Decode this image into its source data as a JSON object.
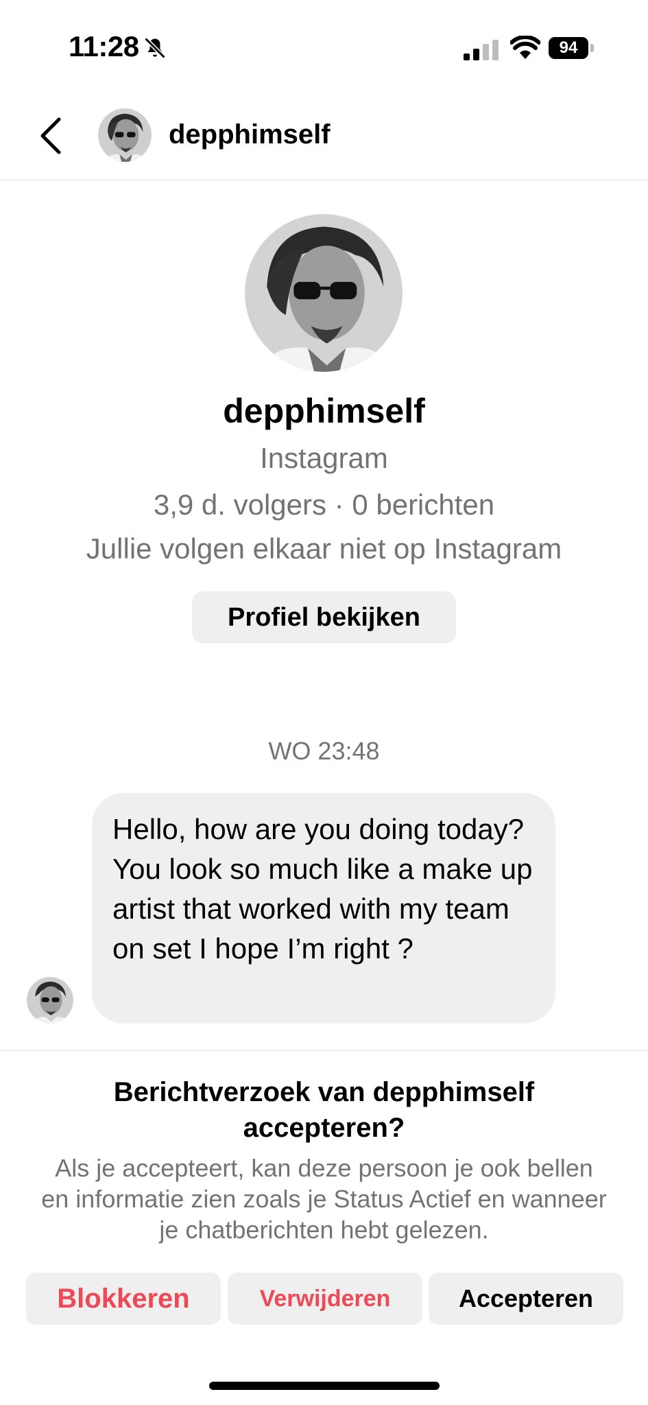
{
  "status_bar": {
    "time": "11:28",
    "battery": "94",
    "mute_icon": "bell-slash-icon"
  },
  "header": {
    "username": "depphimself"
  },
  "profile": {
    "name": "depphimself",
    "subtitle": "Instagram",
    "stats": "3,9 d. volgers · 0 berichten",
    "follow_note": "Jullie volgen elkaar niet op Instagram",
    "view_button": "Profiel bekijken"
  },
  "thread": {
    "timestamp": "WO 23:48",
    "message": "Hello, how are you doing today? You look so much like a make up artist that worked with my team on set I hope I’m right ?"
  },
  "request": {
    "title_line1": "Berichtverzoek van depphimself",
    "title_line2": "accepteren?",
    "description": "Als je accepteert, kan deze persoon je ook bellen en informatie zien zoals je Status Actief en wanneer je chatberichten hebt gelezen.",
    "block_label": "Blokkeren",
    "delete_label": "Verwijderen",
    "accept_label": "Accepteren"
  },
  "colors": {
    "danger": "#ed4956",
    "muted_text": "#737373",
    "button_bg": "#efefef"
  }
}
